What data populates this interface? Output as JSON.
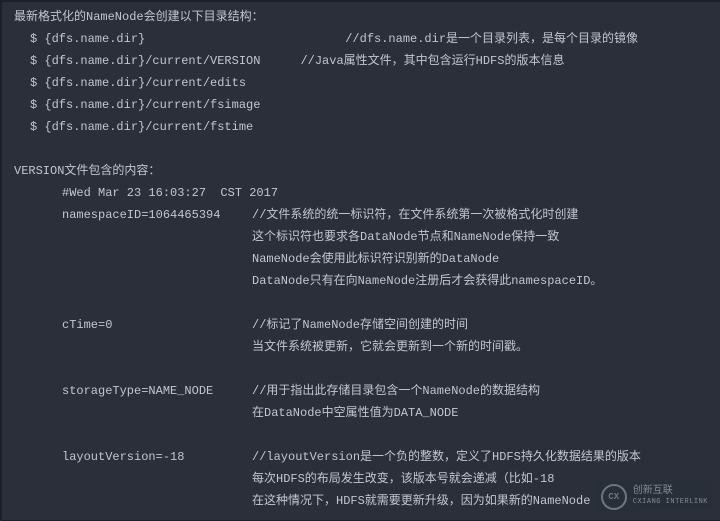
{
  "l1": "最新格式化的NameNode会创建以下目录结构：",
  "l2a": "$ {dfs.name.dir}",
  "l2b": "//dfs.name.dir是一个目录列表，是每个目录的镜像",
  "l3a": "$ {dfs.name.dir}/current/VERSION",
  "l3b": "//Java属性文件，其中包含运行HDFS的版本信息",
  "l4": "$ {dfs.name.dir}/current/edits",
  "l5": "$ {dfs.name.dir}/current/fsimage",
  "l6": "$ {dfs.name.dir}/current/fstime",
  "h2": "VERSION文件包含的内容：",
  "v1": "#Wed Mar 23 16:03:27  CST 2017",
  "v2a": "namespaceID=1064465394",
  "v2b": "//文件系统的统一标识符，在文件系统第一次被格式化时创建",
  "v2c": "这个标识符也要求各DataNode节点和NameNode保持一致",
  "v2d": "NameNode会使用此标识符识别新的DataNode",
  "v2e": "DataNode只有在向NameNode注册后才会获得此namespaceID。",
  "v3a": "cTime=0",
  "v3b": "//标记了NameNode存储空间创建的时间",
  "v3c": "当文件系统被更新，它就会更新到一个新的时间戳。",
  "v4a": "storageType=NAME_NODE",
  "v4b": "//用于指出此存储目录包含一个NameNode的数据结构",
  "v4c": "在DataNode中空属性值为DATA_NODE",
  "v5a": "layoutVersion=-18",
  "v5b": "//layoutVersion是一个负的整数，定义了HDFS持久化数据结果的版本",
  "v5c": "每次HDFS的布局发生改变，该版本号就会递减（比如-18",
  "v5d": "在这种情况下，HDFS就需要更新升级，因为如果新的NameNode",
  "wm_logo": "CX",
  "wm_cn": "创新互联",
  "wm_py": "CXIANG INTERLINK"
}
